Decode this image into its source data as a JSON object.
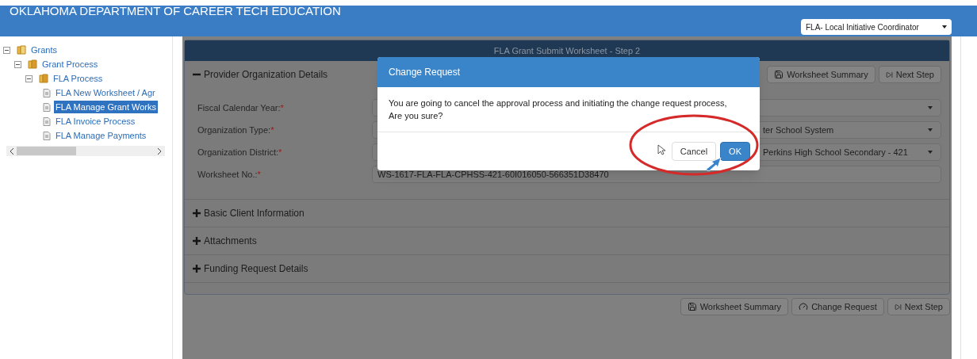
{
  "header": {
    "title": "OKLAHOMA DEPARTMENT OF CAREER TECH EDUCATION",
    "role_select": {
      "value": "FLA- Local Initiative Coordinator"
    }
  },
  "sidebar": {
    "tree": [
      {
        "label": "Grants",
        "kind": "book",
        "expanded": true,
        "selected": false,
        "children": [
          {
            "label": "Grant Process",
            "kind": "folder",
            "expanded": true,
            "selected": false,
            "children": [
              {
                "label": "FLA Process",
                "kind": "folder",
                "expanded": true,
                "selected": false,
                "children": [
                  {
                    "label": "FLA New Worksheet / Agr",
                    "kind": "page",
                    "selected": false
                  },
                  {
                    "label": "FLA Manage Grant Works",
                    "kind": "page",
                    "selected": true
                  },
                  {
                    "label": "FLA Invoice Process",
                    "kind": "page",
                    "selected": false
                  },
                  {
                    "label": "FLA Manage Payments",
                    "kind": "page",
                    "selected": false
                  }
                ]
              }
            ]
          }
        ]
      }
    ]
  },
  "panel": {
    "title": "FLA Grant Submit Worksheet - Step 2",
    "toolbar": [
      {
        "label": "Worksheet Summary",
        "kind": "summary"
      },
      {
        "label": "Next Step",
        "kind": "next"
      }
    ],
    "sections": [
      {
        "title": "Provider Organization Details",
        "expanded": true,
        "fields": [
          {
            "label": "Fiscal Calendar Year:",
            "required_mark": "*",
            "kind": "select"
          },
          {
            "label": "Organization Type:",
            "required_mark": "*",
            "kind": "select",
            "value": "ter School System"
          },
          {
            "label": "Organization District:",
            "required_mark": "*",
            "kind": "select",
            "value": "Perkins High School Secondary - 421"
          },
          {
            "label": "Worksheet No.:",
            "required_mark": "*",
            "kind": "text",
            "value": "WS-1617-FLA-FLA-CPHSS-421-60I016050-566351D38470"
          }
        ]
      },
      {
        "title": "Basic Client Information",
        "expanded": false
      },
      {
        "title": "Attachments",
        "expanded": false
      },
      {
        "title": "Funding Request Details",
        "expanded": false
      }
    ],
    "bottom_buttons": [
      {
        "label": "Worksheet Summary",
        "kind": "summary"
      },
      {
        "label": "Change Request",
        "kind": "change"
      },
      {
        "label": "Next Step",
        "kind": "next"
      }
    ]
  },
  "dialog": {
    "title": "Change Request",
    "message_lines": [
      "You are going to cancel the approval process and initiating the change request process,",
      "Are you sure?"
    ],
    "buttons": [
      {
        "label": "Cancel",
        "kind": "secondary"
      },
      {
        "label": "OK",
        "kind": "primary"
      }
    ]
  }
}
